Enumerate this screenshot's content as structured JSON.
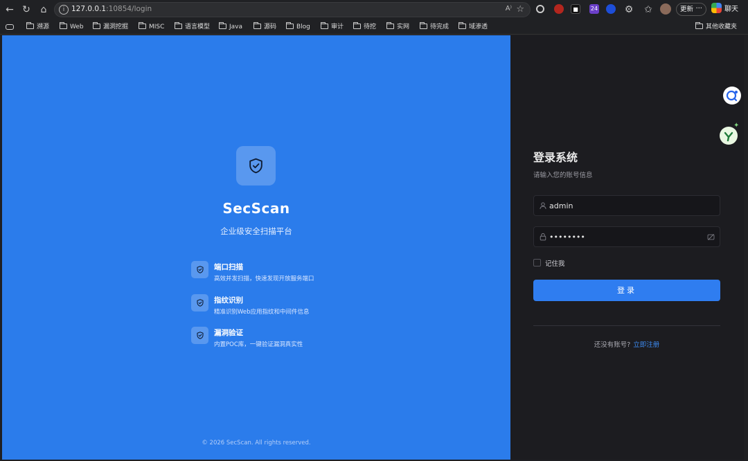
{
  "browser": {
    "url_host": "127.0.0.1",
    "url_rest": ":10854/login",
    "read_aloud": "A⁾",
    "update_label": "更新",
    "update_more": "···",
    "chat_label": "聊天",
    "ext_badge": "24"
  },
  "bookmarks": {
    "items": [
      "溯源",
      "Web",
      "漏洞挖掘",
      "MISC",
      "语言模型",
      "Java",
      "源码",
      "Blog",
      "审计",
      "待挖",
      "实网",
      "待完成",
      "域渗透"
    ],
    "other": "其他收藏夹"
  },
  "left": {
    "brand": "SecScan",
    "tagline": "企业级安全扫描平台",
    "features": [
      {
        "title": "端口扫描",
        "desc": "高效并发扫描，快速发现开放服务端口"
      },
      {
        "title": "指纹识别",
        "desc": "精准识别Web应用指纹和中间件信息"
      },
      {
        "title": "漏洞验证",
        "desc": "内置POC库，一键验证漏洞真实性"
      }
    ],
    "copyright": "© 2026 SecScan. All rights reserved."
  },
  "login": {
    "title": "登录系统",
    "subtitle": "请输入您的账号信息",
    "username_value": "admin",
    "password_value": "••••••••",
    "remember_label": "记住我",
    "submit_label": "登录",
    "register_prompt": "还没有账号?",
    "register_link": "立即注册"
  },
  "colors": {
    "primary": "#2b7ceb",
    "button": "#2f7df0",
    "panel_dark": "#1c1c20"
  }
}
